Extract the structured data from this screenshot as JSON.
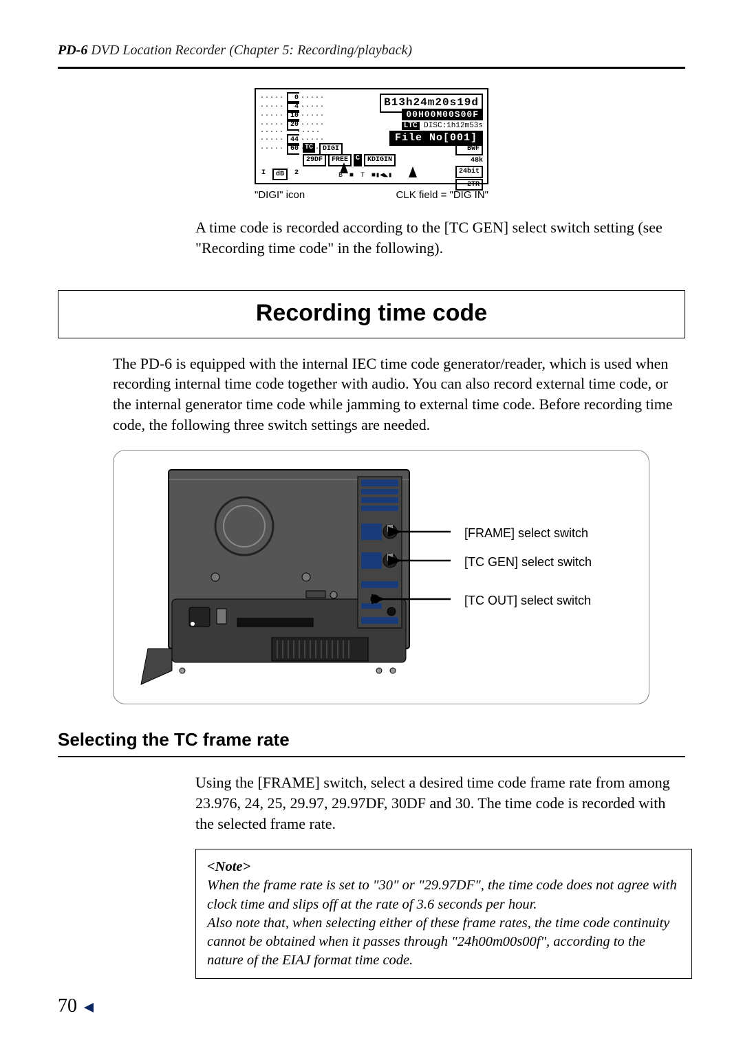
{
  "header": {
    "model": "PD-6",
    "title_rest": " DVD Location Recorder (Chapter 5: Recording/playback)"
  },
  "lcd": {
    "line1": "B13h24m20s19d",
    "line2_tc": "00H00M00S00F",
    "line3_prefix": "LTC",
    "line3_rest": " DISC:1h12m53s",
    "line4": "File No[001]",
    "row5_tc": "TC",
    "row5_digi": "DIGI",
    "row5_bwf": "BWF",
    "row6_a": "29DF",
    "row6_b": "FREE",
    "row6_c_inv": "C",
    "row6_kdigin": "KDIGIN",
    "right_48k": "48k",
    "right_bit": "24bit",
    "right_2tr": "2TR",
    "scale": [
      "0",
      "4",
      "10",
      "20",
      "44",
      "60"
    ],
    "bottom_i": "I",
    "bottom_db": "dB",
    "bottom_2": "2",
    "row7_b": "B",
    "row7_t": "T"
  },
  "lcd_captions": {
    "left": "\"DIGI\" icon",
    "right": "CLK field = \"DIG IN\""
  },
  "para_after_lcd": "A time code is recorded according to the [TC GEN] select switch setting (see \"Recording time code\" in the following).",
  "section_title": "Recording time code",
  "section_intro": "The PD-6 is equipped with the internal IEC time code generator/reader, which is used when recording internal time code together with audio. You can also record external time code, or the internal generator time code while jamming to external time code. Before recording time code, the following three switch settings are needed.",
  "device_callouts": {
    "frame": "[FRAME] select switch",
    "tcgen": "[TC GEN] select switch",
    "tcout": "[TC OUT] select switch"
  },
  "sub_heading": "Selecting the TC frame rate",
  "sub_para": "Using the [FRAME] switch, select a desired time code frame rate from among 23.976, 24, 25, 29.97, 29.97DF, 30DF and 30. The time code is recorded with the selected frame rate.",
  "note": {
    "title": "<Note>",
    "body1": "When the frame rate is set to \"30\" or \"29.97DF\", the time code does not agree with clock time and slips off at the rate of 3.6 seconds per hour.",
    "body2": "Also note that, when selecting either of these frame rates, the time code continuity cannot be obtained when it passes through \"24h00m00s00f\", according to the nature of the EIAJ format time code."
  },
  "page_number": "70"
}
